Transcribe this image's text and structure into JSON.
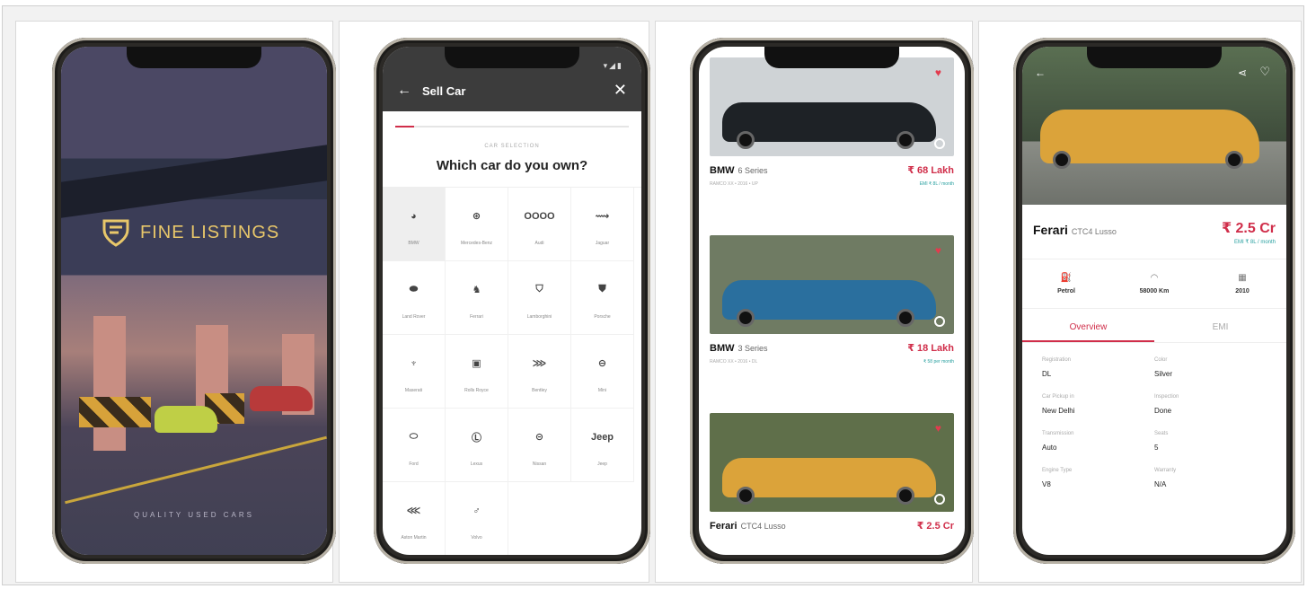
{
  "splash": {
    "brand": "FINE LISTINGS",
    "tagline": "QUALITY USED CARS",
    "accent": "#e8c76a"
  },
  "sell": {
    "title": "Sell Car",
    "status": "▾◢▮",
    "step": "CAR SELECTION",
    "question": "Which car do you own?",
    "progress_percent": 8,
    "accent": "#d02e4a",
    "brands": [
      {
        "name": "BMW",
        "glyph": "◕",
        "selected": true
      },
      {
        "name": "Mercedes-Benz",
        "glyph": "⊛",
        "selected": false
      },
      {
        "name": "Audi",
        "glyph": "OOOO",
        "selected": false
      },
      {
        "name": "Jaguar",
        "glyph": "⟿",
        "selected": false
      },
      {
        "name": "Land Rover",
        "glyph": "⬬",
        "selected": false
      },
      {
        "name": "Ferrari",
        "glyph": "♞",
        "selected": false
      },
      {
        "name": "Lamborghini",
        "glyph": "⛉",
        "selected": false
      },
      {
        "name": "Porsche",
        "glyph": "⛊",
        "selected": false
      },
      {
        "name": "Maserati",
        "glyph": "♆",
        "selected": false
      },
      {
        "name": "Rolls Royce",
        "glyph": "▣",
        "selected": false
      },
      {
        "name": "Bentley",
        "glyph": "⋙",
        "selected": false
      },
      {
        "name": "Mini",
        "glyph": "⊖",
        "selected": false
      },
      {
        "name": "Ford",
        "glyph": "⬭",
        "selected": false
      },
      {
        "name": "Lexus",
        "glyph": "Ⓛ",
        "selected": false
      },
      {
        "name": "Nissan",
        "glyph": "⊝",
        "selected": false
      },
      {
        "name": "Jeep",
        "glyph": "Jeep",
        "selected": false
      },
      {
        "name": "Aston Martin",
        "glyph": "⋘",
        "selected": false
      },
      {
        "name": "Volvo",
        "glyph": "♂",
        "selected": false
      }
    ]
  },
  "listings": [
    {
      "make": "BMW",
      "model": "6 Series",
      "price": "₹ 68 Lakh",
      "meta": "RAMCO XX • 2016 • UP",
      "emi": "EMI ₹ 8L / month",
      "color": "#1e2226",
      "bg": "#cfd3d6"
    },
    {
      "make": "BMW",
      "model": "3 Series",
      "price": "₹ 18 Lakh",
      "meta": "RAMCO XX • 2016 • DL",
      "emi": "₹ 58 per month",
      "color": "#2a6f9e",
      "bg": "#6f7b63"
    },
    {
      "make": "Ferari",
      "model": "CTC4 Lusso",
      "price": "₹ 2.5 Cr",
      "meta": "",
      "emi": "",
      "color": "#dba33a",
      "bg": "#5f6f4a"
    }
  ],
  "detail": {
    "make": "Ferari",
    "model": "CTC4 Lusso",
    "price": "₹ 2.5 Cr",
    "emi": "EMI ₹ 8L / month",
    "specs": [
      {
        "icon": "fuel-icon",
        "glyph": "⛽",
        "label": "Petrol"
      },
      {
        "icon": "speedometer-icon",
        "glyph": "◠",
        "label": "58000 Km"
      },
      {
        "icon": "calendar-icon",
        "glyph": "▦",
        "label": "2010"
      }
    ],
    "tabs": [
      {
        "label": "Overview",
        "active": true
      },
      {
        "label": "EMI",
        "active": false
      }
    ],
    "attributes": [
      {
        "key": "Registration",
        "value": "DL"
      },
      {
        "key": "Color",
        "value": "Silver"
      },
      {
        "key": "Car Pickup in",
        "value": "New Delhi"
      },
      {
        "key": "Inspection",
        "value": "Done"
      },
      {
        "key": "Transmission",
        "value": "Auto"
      },
      {
        "key": "Seats",
        "value": "5"
      },
      {
        "key": "Engine Type",
        "value": "V8"
      },
      {
        "key": "Warranty",
        "value": "N/A"
      }
    ]
  }
}
